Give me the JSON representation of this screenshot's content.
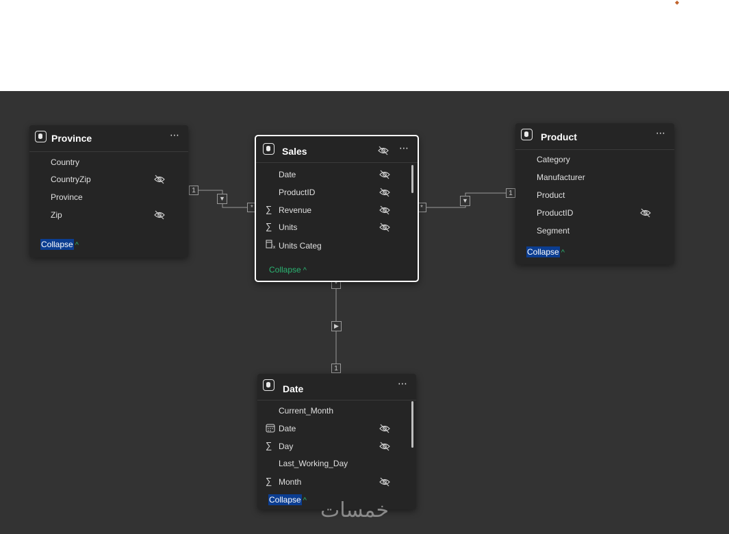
{
  "tables": {
    "province": {
      "title": "Province",
      "fields": [
        "Country",
        "CountryZip",
        "Province",
        "Zip"
      ],
      "collapse_label": "Collapse"
    },
    "sales": {
      "title": "Sales",
      "fields": [
        "Date",
        "ProductID",
        "Revenue",
        "Units",
        "Units Categ"
      ],
      "collapse_label": "Collapse"
    },
    "product": {
      "title": "Product",
      "fields": [
        "Category",
        "Manufacturer",
        "Product",
        "ProductID",
        "Segment"
      ],
      "collapse_label": "Collapse"
    },
    "date": {
      "title": "Date",
      "fields": [
        "Current_Month",
        "Date",
        "Day",
        "Last_Working_Day",
        "Month"
      ],
      "collapse_label": "Collapse"
    }
  },
  "relationships": {
    "province_sales": {
      "from_cardinality": "1",
      "to_cardinality": "*"
    },
    "product_sales": {
      "from_cardinality": "1",
      "to_cardinality": "*"
    },
    "date_sales": {
      "from_cardinality": "1",
      "to_cardinality": "*"
    }
  },
  "icons": {
    "more": "⋯",
    "sigma": "∑",
    "chevron_up": "^"
  },
  "watermark": "خمسات",
  "colors": {
    "canvas": "#333333",
    "card": "#252525",
    "accent_green": "#2bb673",
    "selection_blue": "#0b3d91"
  }
}
